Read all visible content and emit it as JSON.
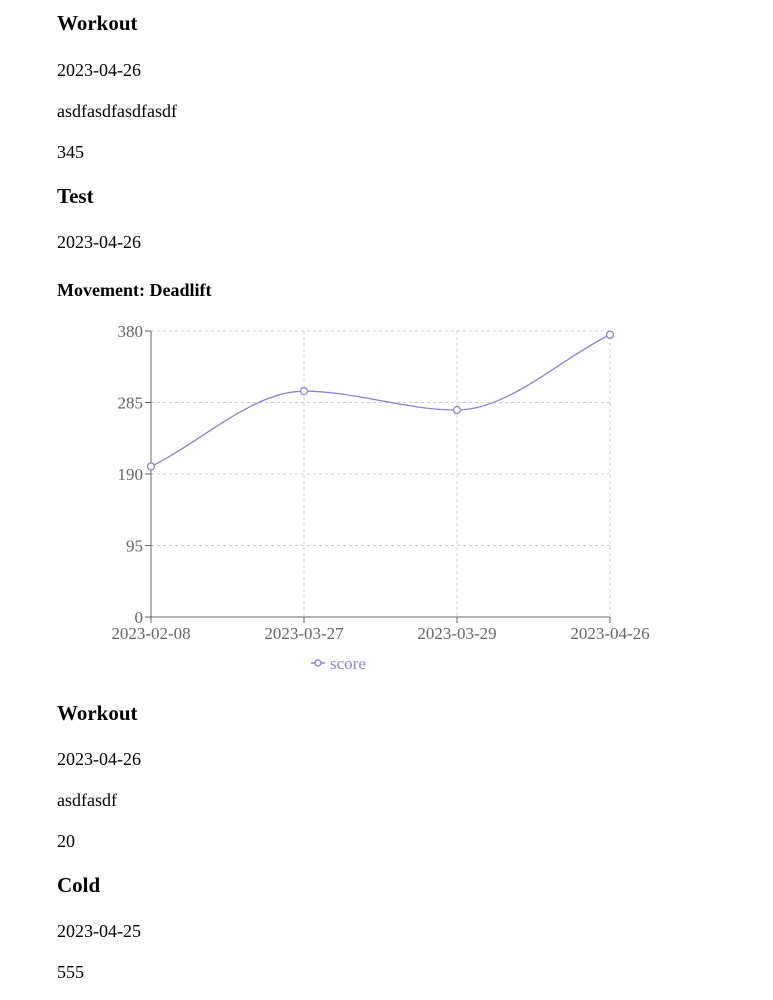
{
  "entries": [
    {
      "title": "Workout",
      "date": "2023-04-26",
      "description": "asdfasdfasdfasdf",
      "value": "345"
    },
    {
      "title": "Test",
      "date": "2023-04-26",
      "movement": "Movement: Deadlift"
    },
    {
      "title": "Workout",
      "date": "2023-04-26",
      "description": "asdfasdf",
      "value": "20"
    },
    {
      "title": "Cold",
      "date": "2023-04-25",
      "value": "555"
    }
  ],
  "chart_data": {
    "type": "line",
    "categories": [
      "2023-02-08",
      "2023-03-27",
      "2023-03-29",
      "2023-04-26"
    ],
    "series": [
      {
        "name": "score",
        "values": [
          200,
          300,
          275,
          375
        ]
      }
    ],
    "yticks": [
      0,
      95,
      190,
      285,
      380
    ],
    "ylim": [
      0,
      380
    ],
    "grid": true,
    "legend": "bottom-center",
    "line_color": "#8884d8",
    "axis_color": "#666666",
    "grid_color": "#cccccc"
  }
}
